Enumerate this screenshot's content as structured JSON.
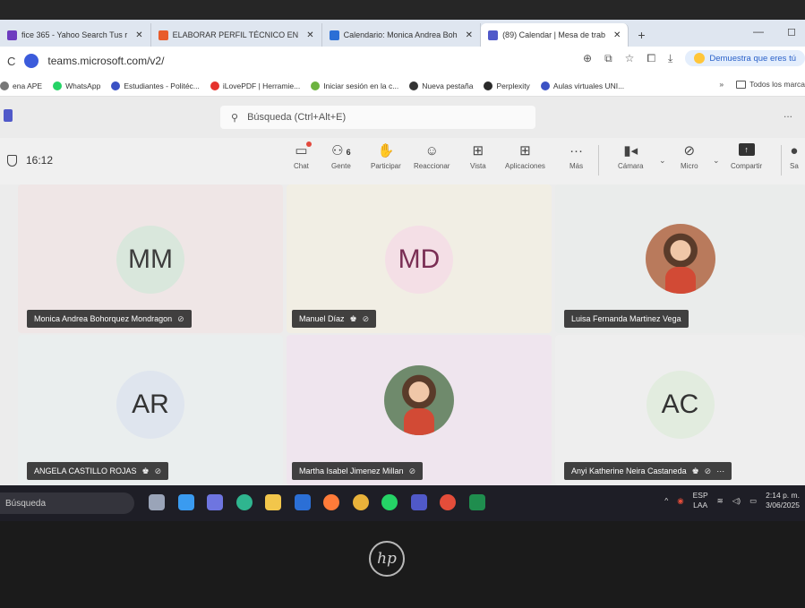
{
  "browser": {
    "tabs": [
      {
        "title": "fice 365 - Yahoo Search Tus r",
        "color": "#6d3bbf",
        "active": false
      },
      {
        "title": "ELABORAR PERFIL TÉCNICO EN",
        "color": "#e85c2b",
        "active": false
      },
      {
        "title": "Calendario: Monica Andrea Boh",
        "color": "#2b6fd6",
        "active": false
      },
      {
        "title": "(89) Calendar | Mesa de trab",
        "color": "#5059c9",
        "active": true
      }
    ],
    "new_tab_icon": "plus",
    "window_controls": {
      "minimize": "—",
      "restore": "◻"
    },
    "url": "teams.microsoft.com/v2/",
    "promo_text": "Demuestra que eres tú",
    "bookmarks": [
      {
        "label": "ena APE",
        "color": "#777777"
      },
      {
        "label": "WhatsApp",
        "color": "#25d366"
      },
      {
        "label": "Estudiantes - Politéc...",
        "color": "#3b52c4"
      },
      {
        "label": "iLovePDF | Herramie...",
        "color": "#e5322d"
      },
      {
        "label": "Iniciar sesión en la c...",
        "color": "#6cb33f"
      },
      {
        "label": "Nueva pestaña",
        "color": "#333333"
      },
      {
        "label": "Perplexity",
        "color": "#2a2a2a"
      },
      {
        "label": "Aulas virtuales UNI...",
        "color": "#3b52c4"
      }
    ],
    "bookmarks_more": "»",
    "all_bookmarks": "Todos los marca"
  },
  "teams": {
    "search_placeholder": "Búsqueda (Ctrl+Alt+E)",
    "more": "...",
    "timer": "16:12",
    "toolbar": {
      "chat": "Chat",
      "people": "Gente",
      "people_count": "6",
      "raise": "Participar",
      "react": "Reaccionar",
      "view": "Vista",
      "apps": "Aplicaciones",
      "more": "Más",
      "camera": "Cámara",
      "mic": "Micro",
      "share": "Compartir",
      "leave": "Sa"
    }
  },
  "participants": [
    {
      "name": "Monica Andrea Bohorquez Mondragon",
      "initials": "MM",
      "avatar_bg": "#d9e7dc",
      "avatar_fg": "#3d3d3d",
      "tile_bg": "#efe6e6",
      "organizer": false,
      "muted": true,
      "photo": false
    },
    {
      "name": "Manuel Díaz",
      "initials": "MD",
      "avatar_bg": "#f4dfe6",
      "avatar_fg": "#7a2e54",
      "tile_bg": "#f1eee4",
      "organizer": true,
      "muted": true,
      "photo": false
    },
    {
      "name": "Luisa Fernanda Martinez Vega",
      "initials": "",
      "avatar_bg": "#b97a5c",
      "avatar_fg": "#ffffff",
      "tile_bg": "#eaeceb",
      "organizer": false,
      "muted": false,
      "photo": true
    },
    {
      "name": "ANGELA CASTILLO ROJAS",
      "initials": "AR",
      "avatar_bg": "#dfe5ee",
      "avatar_fg": "#333333",
      "tile_bg": "#eaeeee",
      "organizer": true,
      "muted": true,
      "photo": false
    },
    {
      "name": "Martha Isabel Jimenez Millan",
      "initials": "",
      "avatar_bg": "#6f8a6c",
      "avatar_fg": "#ffffff",
      "tile_bg": "#efe5ee",
      "organizer": false,
      "muted": true,
      "photo": true
    },
    {
      "name": "Anyi Katherine Neira Castaneda",
      "initials": "AC",
      "avatar_bg": "#e2ecdf",
      "avatar_fg": "#333333",
      "tile_bg": "#eeeeee",
      "organizer": true,
      "muted": true,
      "photo": false,
      "more": "···"
    }
  ],
  "taskbar": {
    "search": "Búsqueda",
    "language": "ESP",
    "region": "LAA",
    "time": "2:14 p. m.",
    "date": "3/06/2025",
    "apps": [
      {
        "name": "taskview",
        "color": "#9aa4b8"
      },
      {
        "name": "start",
        "color": "#3a9bf0"
      },
      {
        "name": "chat",
        "color": "#6e75e0"
      },
      {
        "name": "edge",
        "color": "#2fb58f"
      },
      {
        "name": "explorer",
        "color": "#f2c64b"
      },
      {
        "name": "word",
        "color": "#2b6fd6"
      },
      {
        "name": "firefox",
        "color": "#ff7b39"
      },
      {
        "name": "chrome",
        "color": "#e9b23a"
      },
      {
        "name": "whatsapp",
        "color": "#25d366"
      },
      {
        "name": "teams",
        "color": "#5059c9"
      },
      {
        "name": "chrome-2",
        "color": "#e44d3a"
      },
      {
        "name": "excel",
        "color": "#1f8d4e"
      }
    ]
  },
  "laptop_brand": "hp"
}
